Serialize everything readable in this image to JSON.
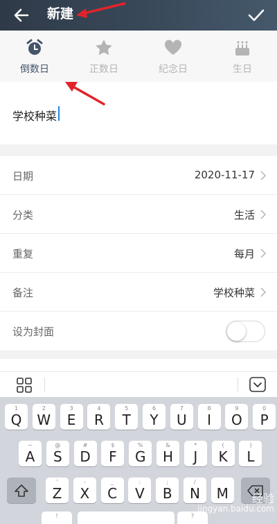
{
  "header": {
    "title": "新建"
  },
  "tabs": [
    {
      "label": "倒数日",
      "icon": "alarm-clock-icon",
      "active": true
    },
    {
      "label": "正数日",
      "icon": "star-icon",
      "active": false
    },
    {
      "label": "纪念日",
      "icon": "heart-icon",
      "active": false
    },
    {
      "label": "生日",
      "icon": "birthday-cake-icon",
      "active": false
    }
  ],
  "name_input": {
    "value": "学校种菜"
  },
  "settings": {
    "date": {
      "label": "日期",
      "value": "2020-11-17"
    },
    "category": {
      "label": "分类",
      "value": "生活"
    },
    "repeat": {
      "label": "重复",
      "value": "每月"
    },
    "note": {
      "label": "备注",
      "value": "学校种菜"
    },
    "cover": {
      "label": "设为封面",
      "on": false
    }
  },
  "keyboard": {
    "row1": [
      {
        "main": "Q",
        "sub": "1"
      },
      {
        "main": "W",
        "sub": "2"
      },
      {
        "main": "E",
        "sub": "3"
      },
      {
        "main": "R",
        "sub": "4"
      },
      {
        "main": "T",
        "sub": "5"
      },
      {
        "main": "Y",
        "sub": "6"
      },
      {
        "main": "U",
        "sub": "7"
      },
      {
        "main": "I",
        "sub": "8"
      },
      {
        "main": "O",
        "sub": "9"
      },
      {
        "main": "P",
        "sub": "0"
      }
    ],
    "row2": [
      {
        "main": "A",
        "sub": "~"
      },
      {
        "main": "S",
        "sub": "@"
      },
      {
        "main": "D",
        "sub": "#"
      },
      {
        "main": "F",
        "sub": "$"
      },
      {
        "main": "G",
        "sub": "%"
      },
      {
        "main": "H",
        "sub": "&"
      },
      {
        "main": "J",
        "sub": "*"
      },
      {
        "main": "K",
        "sub": "("
      },
      {
        "main": "L",
        "sub": ")"
      }
    ],
    "row3": [
      {
        "main": "Z",
        "sub": "'"
      },
      {
        "main": "X",
        "sub": "-"
      },
      {
        "main": "C",
        "sub": "_"
      },
      {
        "main": "V",
        "sub": ":"
      },
      {
        "main": "B",
        "sub": ";"
      },
      {
        "main": "N",
        "sub": "/"
      },
      {
        "main": "M",
        "sub": ""
      }
    ],
    "row4": [
      {
        "main": "",
        "sub": "!"
      },
      {
        "main": "",
        "sub": "?"
      },
      {
        "main": "",
        "sub": ""
      }
    ]
  },
  "watermark": {
    "cn": "经验",
    "url": "jingyan.baidu.com"
  },
  "colors": {
    "header": "#39495a",
    "accent": "#44556a",
    "annotation_arrow": "#e0242b"
  }
}
